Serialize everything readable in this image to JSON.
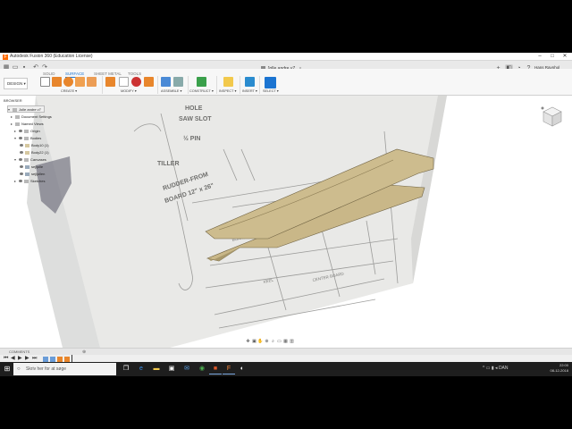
{
  "window": {
    "title": "Autodesk Fusion 360 (Education License)",
    "min_glyph": "–",
    "max_glyph": "□",
    "close_glyph": "✕"
  },
  "docbar": {
    "document_tab": "Jolle andre v7",
    "user_name": "Hans Ravnhol",
    "quick_access": [
      "menu-grid-icon",
      "file-icon",
      "save-icon",
      "undo-icon",
      "redo-icon"
    ]
  },
  "toolbar": {
    "tabs": [
      "SOLID",
      "SURFACE",
      "SHEET METAL",
      "TOOLS"
    ],
    "active_tab": "SURFACE",
    "workspace": "DESIGN ▾",
    "groups": [
      "CREATE ▾",
      "MODIFY ▾",
      "ASSEMBLE ▾",
      "CONSTRUCT ▾",
      "INSPECT ▾",
      "INSERT ▾",
      "SELECT ▾"
    ]
  },
  "browser": {
    "header": "BROWSER",
    "items": [
      {
        "label": "Jolle andre v7",
        "indent": 0
      },
      {
        "label": "Document Settings",
        "indent": 1
      },
      {
        "label": "Named Views",
        "indent": 1
      },
      {
        "label": "Origin",
        "indent": 2
      },
      {
        "label": "Bodies",
        "indent": 2
      },
      {
        "label": "Body10 (1)",
        "indent": 3
      },
      {
        "label": "Body22 (1)",
        "indent": 3
      },
      {
        "label": "Canvases",
        "indent": 2
      },
      {
        "label": "sejljolle",
        "indent": 3
      },
      {
        "label": "sejljollen",
        "indent": 3
      },
      {
        "label": "Sketches",
        "indent": 2
      }
    ]
  },
  "blueprint": {
    "labels": [
      "HOLE",
      "SAW SLOT",
      "½ PIN",
      "TILLER",
      "RUDDER-FROM",
      "BOARD 12\" x 26\"",
      "KEEL",
      "CENTER BOARD",
      "BOARD"
    ]
  },
  "comments": {
    "label": "COMMENTS"
  },
  "timeline": {
    "controls": [
      "⏮",
      "◀",
      "▶",
      "▶",
      "⏭"
    ]
  },
  "taskbar": {
    "search_placeholder": "Skriv her for at søge",
    "apps": [
      "task-view-icon",
      "edge-icon",
      "explorer-icon",
      "store-icon",
      "mail-icon",
      "chrome-icon",
      "office-icon",
      "fusion-icon",
      "app-icon"
    ],
    "language": "DAN",
    "time": "22:00",
    "date": "08-12-2018"
  },
  "colors": {
    "accent": "#1b74d1",
    "surface_fill": "#c9b788",
    "surface_edge": "#6f6242",
    "taskbar": "#1e1e1e"
  }
}
